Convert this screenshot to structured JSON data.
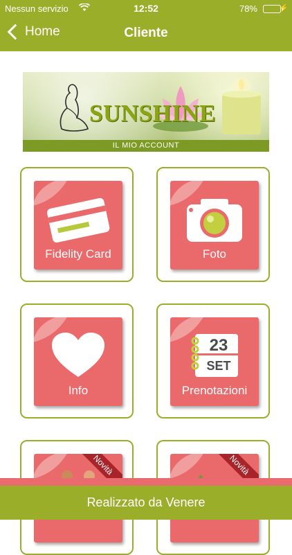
{
  "status_bar": {
    "carrier": "Nessun servizio",
    "time": "12:52",
    "battery_percent": "78%",
    "battery_level": 0.78
  },
  "nav": {
    "back_label": "Home",
    "title": "Cliente"
  },
  "banner": {
    "brand": "SUNSHINE",
    "subtitle": "IL MIO ACCOUNT"
  },
  "tiles": [
    {
      "label": "Fidelity Card",
      "icon": "card-icon"
    },
    {
      "label": "Foto",
      "icon": "camera-icon"
    },
    {
      "label": "Info",
      "icon": "heart-icon"
    },
    {
      "label": "Prenotazioni",
      "icon": "calendar-icon",
      "calendar_day": "23",
      "calendar_month": "SET"
    },
    {
      "label": "",
      "badge": "Novità"
    },
    {
      "label": "",
      "badge": "Novità"
    }
  ],
  "footer": {
    "text": "Realizzato da Venere"
  },
  "colors": {
    "header_green": "#9aae2a",
    "tile_red": "#ea6a6c",
    "ribbon_red": "#a8242a",
    "footer_stripe": "#e96b6d"
  }
}
